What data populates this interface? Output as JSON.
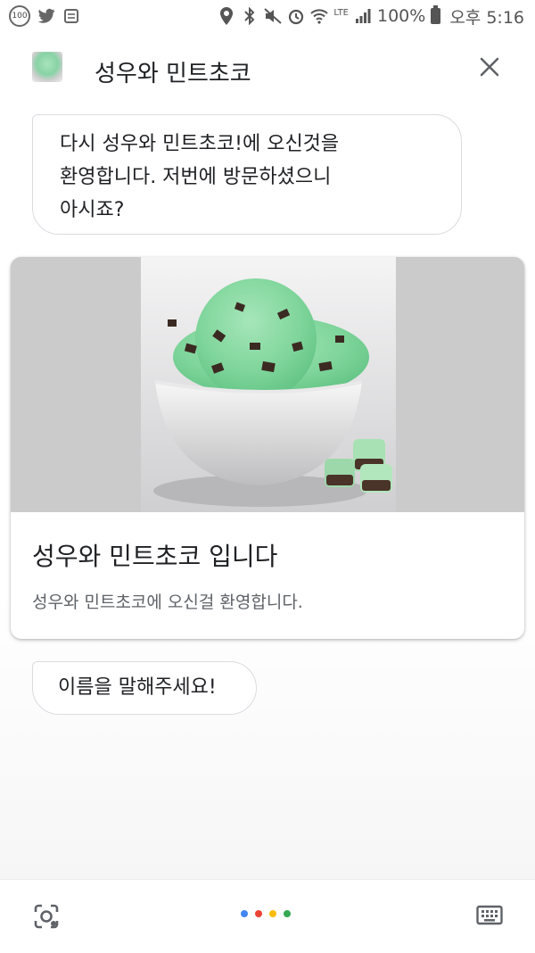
{
  "status_bar": {
    "notification_badge": "100",
    "battery": "100%",
    "network": "LTE",
    "time": "오후 5:16"
  },
  "header": {
    "title": "성우와 민트초코",
    "close_icon": "close-icon"
  },
  "messages": [
    {
      "line1": "다시 성우와 민트초코!에 오신것을",
      "line2": "환영합니다. 저번에 방문하셨으니",
      "line3": "아시죠?"
    }
  ],
  "card": {
    "title": "성우와 민트초코 입니다",
    "subtitle": "성우와 민트초코에 오신걸 환영합니다."
  },
  "prompt": "이름을 말해주세요!",
  "bottom_bar": {
    "left_icon": "lens-icon",
    "right_icon": "keyboard-icon",
    "dot_colors": [
      "#4285F4",
      "#EA4335",
      "#FBBC05",
      "#34A853"
    ]
  }
}
